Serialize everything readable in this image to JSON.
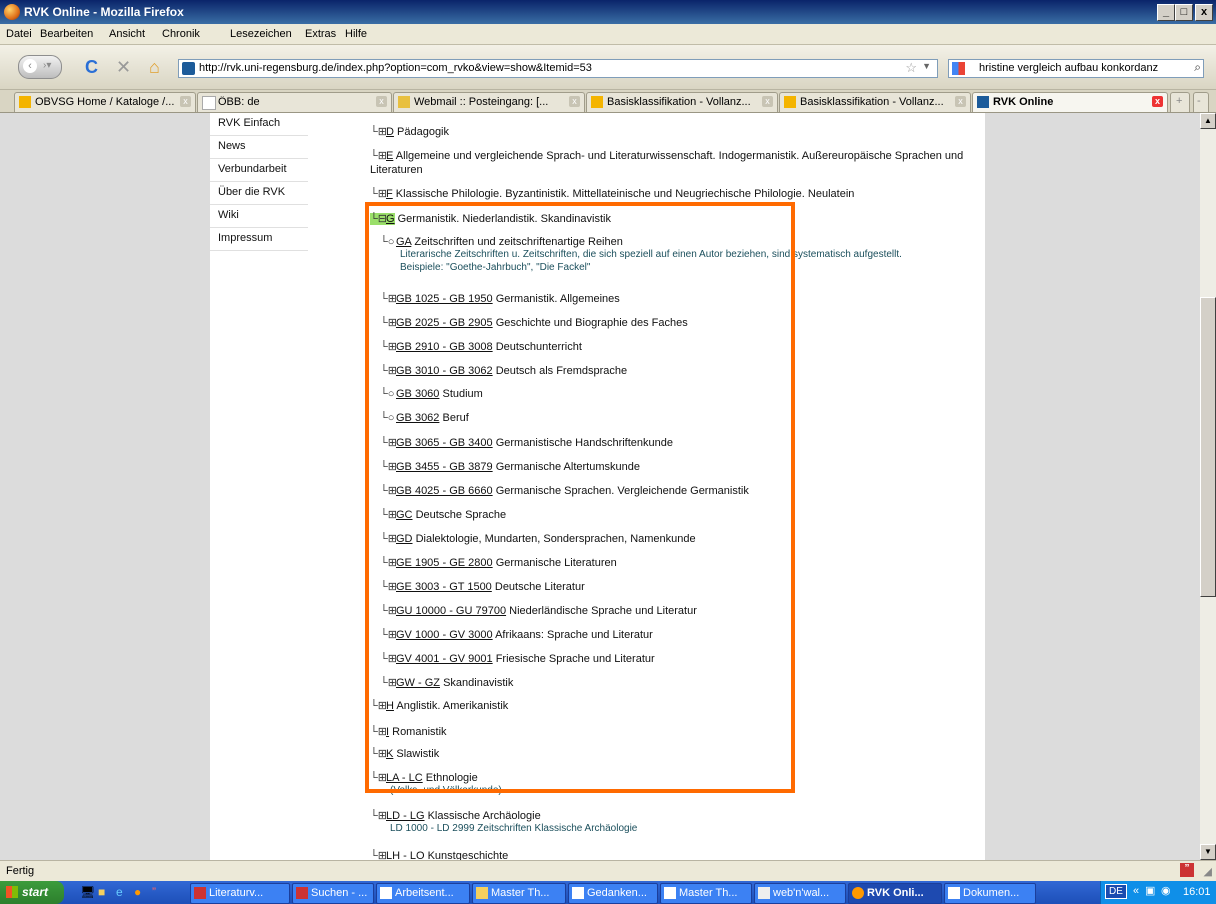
{
  "window": {
    "title": "RVK Online - Mozilla Firefox",
    "buttons": [
      "_",
      "□",
      "x"
    ]
  },
  "menu": [
    "Datei",
    "Bearbeiten",
    "Ansicht",
    "Chronik",
    "Lesezeichen",
    "Extras",
    "Hilfe"
  ],
  "nav": {
    "url": "http://rvk.uni-regensburg.de/index.php?option=com_rvko&view=show&Itemid=53",
    "search_value": "hristine vergleich aufbau konkordanz"
  },
  "tabs": [
    {
      "label": "OBVSG Home / Kataloge /...",
      "active": false
    },
    {
      "label": "ÖBB: de",
      "active": false
    },
    {
      "label": "Webmail :: Posteingang: [...",
      "active": false
    },
    {
      "label": "Basisklassifikation - Vollanz...",
      "active": false
    },
    {
      "label": "Basisklassifikation - Vollanz...",
      "active": false
    },
    {
      "label": "RVK Online",
      "active": true
    }
  ],
  "sidebar": [
    "RVK Einfach",
    "News",
    "Verbundarbeit",
    "Über die RVK",
    "Wiki",
    "Impressum"
  ],
  "tree": {
    "before": [
      {
        "code": "D",
        "text": "Pädagogik"
      },
      {
        "code": "E",
        "text": "Allgemeine und vergleichende Sprach- und Literaturwissenschaft. Indogermanistik. Außereuropäische Sprachen und Literaturen"
      },
      {
        "code": "F",
        "text": "Klassische Philologie. Byzantinistik. Mittellateinische und Neugriechische Philologie. Neulatein"
      }
    ],
    "selected": {
      "code": "G",
      "text": "Germanistik. Niederlandistik. Skandinavistik"
    },
    "children": [
      {
        "code": "GA",
        "text": "Zeitschriften und zeitschriftenartige Reihen",
        "leaf": true,
        "note1": "Literarische Zeitschriften u. Zeitschriften, die sich speziell auf einen Autor beziehen, sind systematisch aufgestellt.",
        "note2": "Beispiele: \"Goethe-Jahrbuch\", \"Die Fackel\""
      },
      {
        "code": "GB 1025 - GB 1950",
        "text": "Germanistik. Allgemeines",
        "leaf": false
      },
      {
        "code": "GB 2025 - GB 2905",
        "text": "Geschichte und Biographie des Faches",
        "leaf": false
      },
      {
        "code": "GB 2910 - GB 3008",
        "text": "Deutschunterricht",
        "leaf": false
      },
      {
        "code": "GB 3010 - GB 3062",
        "text": "Deutsch als Fremdsprache",
        "leaf": false
      },
      {
        "code": "GB 3060",
        "text": "Studium",
        "leaf": true
      },
      {
        "code": "GB 3062",
        "text": "Beruf",
        "leaf": true
      },
      {
        "code": "GB 3065 - GB 3400",
        "text": "Germanistische Handschriftenkunde",
        "leaf": false
      },
      {
        "code": "GB 3455 - GB 3879",
        "text": "Germanische Altertumskunde",
        "leaf": false
      },
      {
        "code": "GB 4025 - GB 6660",
        "text": "Germanische Sprachen. Vergleichende Germanistik",
        "leaf": false
      },
      {
        "code": "GC",
        "text": "Deutsche Sprache",
        "leaf": false
      },
      {
        "code": "GD",
        "text": "Dialektologie, Mundarten, Sondersprachen, Namenkunde",
        "leaf": false
      },
      {
        "code": "GE 1905 - GE 2800",
        "text": "Germanische Literaturen",
        "leaf": false
      },
      {
        "code": "GE 3003 - GT 1500",
        "text": "Deutsche Literatur",
        "leaf": false
      },
      {
        "code": "GU 10000 - GU 79700",
        "text": "Niederländische Sprache und Literatur",
        "leaf": false
      },
      {
        "code": "GV 1000 - GV 3000",
        "text": "Afrikaans: Sprache und Literatur",
        "leaf": false
      },
      {
        "code": "GV 4001 - GV 9001",
        "text": "Friesische Sprache und Literatur",
        "leaf": false
      },
      {
        "code": "GW - GZ",
        "text": "Skandinavistik",
        "leaf": false
      }
    ],
    "after": [
      {
        "code": "H",
        "text": "Anglistik. Amerikanistik"
      },
      {
        "code": "I",
        "text": "Romanistik"
      },
      {
        "code": "K",
        "text": "Slawistik"
      },
      {
        "code": "LA - LC",
        "text": "Ethnologie",
        "note": "(Volks- und Völkerkunde)"
      },
      {
        "code": "LD - LG",
        "text": "Klassische Archäologie",
        "note": "LD 1000 - LD 2999 Zeitschriften Klassische Archäologie"
      },
      {
        "code": "LH - LO",
        "text": "Kunstgeschichte"
      }
    ]
  },
  "status": "Fertig",
  "taskbar": {
    "start": "start",
    "items": [
      {
        "label": "Literaturv...",
        "active": false
      },
      {
        "label": "Suchen - ...",
        "active": false
      },
      {
        "label": "Arbeitsent...",
        "active": false
      },
      {
        "label": "Master Th...",
        "active": false
      },
      {
        "label": "Gedanken...",
        "active": false
      },
      {
        "label": "Master Th...",
        "active": false
      },
      {
        "label": "web'n'wal...",
        "active": false
      },
      {
        "label": "RVK Onli...",
        "active": true
      },
      {
        "label": "Dokumen...",
        "active": false
      }
    ],
    "lang": "DE",
    "clock": "16:01"
  }
}
